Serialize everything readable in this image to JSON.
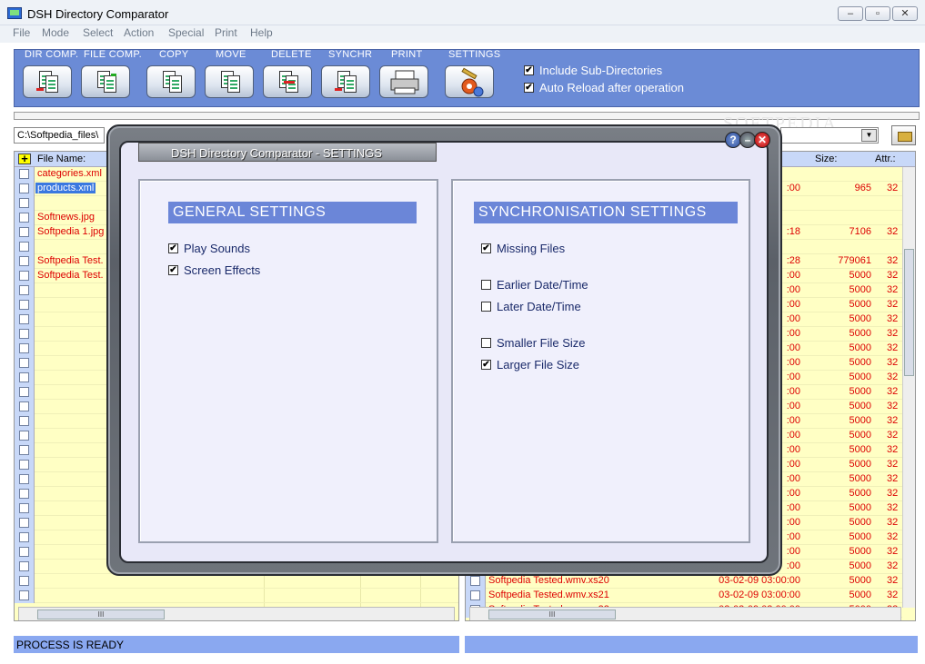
{
  "window": {
    "title": "DSH Directory Comparator",
    "minimize": "–",
    "restore": "▫",
    "close": "✕"
  },
  "menu": [
    "File",
    "Mode",
    "Select",
    "Action",
    "Special",
    "Print",
    "Help"
  ],
  "toolbar": {
    "buttons": [
      {
        "label": "DIR COMP.",
        "icon": "dir-compare-icon"
      },
      {
        "label": "FILE COMP.",
        "icon": "file-compare-icon"
      },
      {
        "label": "COPY",
        "icon": "copy-icon"
      },
      {
        "label": "MOVE",
        "icon": "move-icon"
      },
      {
        "label": "DELETE",
        "icon": "delete-icon"
      },
      {
        "label": "SYNCHR",
        "icon": "synchronize-icon"
      },
      {
        "label": "PRINT",
        "icon": "printer-icon"
      },
      {
        "label": "SETTINGS",
        "icon": "settings-icon"
      }
    ],
    "include_subdirs": {
      "label": "Include Sub-Directories",
      "checked": true
    },
    "auto_reload": {
      "label": "Auto Reload after operation",
      "checked": true
    }
  },
  "left_path": "C:\\Softpedia_files\\",
  "watermark": "SOFTPEDIA",
  "left_panel": {
    "add_symbol": "+",
    "header": "File Name:",
    "files": [
      {
        "name": "categories.xml",
        "selected": false
      },
      {
        "name": "products.xml",
        "selected": true
      },
      {
        "name": "",
        "selected": false
      },
      {
        "name": "Softnews.jpg",
        "selected": false
      },
      {
        "name": "Softpedia 1.jpg",
        "selected": false
      },
      {
        "name": "",
        "selected": false
      },
      {
        "name": "Softpedia Test.",
        "selected": false
      },
      {
        "name": "Softpedia Test.",
        "selected": false
      }
    ]
  },
  "right_panel": {
    "headers": {
      "size": "Size:",
      "attr": "Attr.:"
    },
    "rows": [
      {
        "name": "",
        "date": "",
        "size": "",
        "attr": ""
      },
      {
        "name": "",
        "date": ":00",
        "size": "965",
        "attr": "32"
      },
      {
        "name": "",
        "date": "",
        "size": "",
        "attr": ""
      },
      {
        "name": "",
        "date": "",
        "size": "",
        "attr": ""
      },
      {
        "name": "",
        "date": ":18",
        "size": "7106",
        "attr": "32"
      },
      {
        "name": "",
        "date": "",
        "size": "",
        "attr": ""
      },
      {
        "name": "",
        "date": ":28",
        "size": "779061",
        "attr": "32"
      },
      {
        "name": "",
        "date": ":00",
        "size": "5000",
        "attr": "32"
      },
      {
        "name": "",
        "date": ":00",
        "size": "5000",
        "attr": "32"
      },
      {
        "name": "",
        "date": ":00",
        "size": "5000",
        "attr": "32"
      },
      {
        "name": "",
        "date": ":00",
        "size": "5000",
        "attr": "32"
      },
      {
        "name": "",
        "date": ":00",
        "size": "5000",
        "attr": "32"
      },
      {
        "name": "",
        "date": ":00",
        "size": "5000",
        "attr": "32"
      },
      {
        "name": "",
        "date": ":00",
        "size": "5000",
        "attr": "32"
      },
      {
        "name": "",
        "date": ":00",
        "size": "5000",
        "attr": "32"
      },
      {
        "name": "",
        "date": ":00",
        "size": "5000",
        "attr": "32"
      },
      {
        "name": "",
        "date": ":00",
        "size": "5000",
        "attr": "32"
      },
      {
        "name": "",
        "date": ":00",
        "size": "5000",
        "attr": "32"
      },
      {
        "name": "",
        "date": ":00",
        "size": "5000",
        "attr": "32"
      },
      {
        "name": "",
        "date": ":00",
        "size": "5000",
        "attr": "32"
      },
      {
        "name": "",
        "date": ":00",
        "size": "5000",
        "attr": "32"
      },
      {
        "name": "",
        "date": ":00",
        "size": "5000",
        "attr": "32"
      },
      {
        "name": "",
        "date": ":00",
        "size": "5000",
        "attr": "32"
      },
      {
        "name": "",
        "date": ":00",
        "size": "5000",
        "attr": "32"
      },
      {
        "name": "",
        "date": ":00",
        "size": "5000",
        "attr": "32"
      },
      {
        "name": "",
        "date": ":00",
        "size": "5000",
        "attr": "32"
      },
      {
        "name": "",
        "date": ":00",
        "size": "5000",
        "attr": "32"
      },
      {
        "name": "",
        "date": ":00",
        "size": "5000",
        "attr": "32"
      },
      {
        "name": "Softpedia Tested.wmv.xs20",
        "date": "03-02-09 03:00:00",
        "size": "5000",
        "attr": "32"
      },
      {
        "name": "Softpedia Tested.wmv.xs21",
        "date": "03-02-09 03:00:00",
        "size": "5000",
        "attr": "32"
      },
      {
        "name": "Softpedia Tested.wmv.xs22",
        "date": "03-02-09 03:00:00",
        "size": "5000",
        "attr": "32"
      }
    ]
  },
  "status": {
    "left": "PROCESS IS READY",
    "right": ""
  },
  "dialog": {
    "title": "DSH Directory Comparator - SETTINGS",
    "help": "?",
    "minimize": "–",
    "close": "✕",
    "general": {
      "heading": "GENERAL SETTINGS",
      "options": [
        {
          "label": "Play Sounds",
          "checked": true
        },
        {
          "label": "Screen Effects",
          "checked": true
        }
      ]
    },
    "sync": {
      "heading": "SYNCHRONISATION SETTINGS",
      "options": [
        {
          "label": "Missing Files",
          "checked": true
        },
        {
          "label": "Earlier Date/Time",
          "checked": false
        },
        {
          "label": "Later Date/Time",
          "checked": false
        },
        {
          "label": "Smaller File Size",
          "checked": false
        },
        {
          "label": "Larger File Size",
          "checked": true
        }
      ]
    }
  },
  "scroll_glyph": "III",
  "check_glyph": "✔"
}
